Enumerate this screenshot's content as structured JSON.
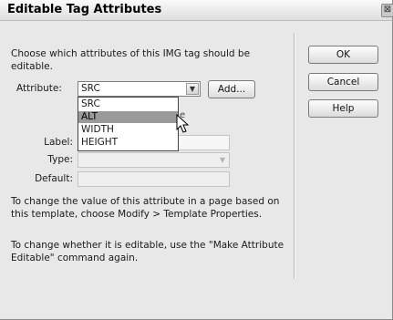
{
  "dialog": {
    "title": "Editable Tag Attributes",
    "close_glyph": "⊠",
    "description": "Choose which attributes of this IMG tag should be editable."
  },
  "attribute": {
    "label": "Attribute:",
    "selected_value": "SRC",
    "options": [
      "SRC",
      "ALT",
      "WIDTH",
      "HEIGHT"
    ],
    "highlighted_index": 1,
    "add_button": "Add..."
  },
  "fields": {
    "label_label": "Label:",
    "type_label": "Type:",
    "default_label": "Default:"
  },
  "hints": {
    "template_hint": "To change the value of this attribute in a page based on this template, choose Modify > Template Properties.",
    "editable_hint": "To change whether it is editable, use the \"Make Attribute Editable\" command again."
  },
  "buttons": {
    "ok": "OK",
    "cancel": "Cancel",
    "help": "Help"
  },
  "icons": {
    "close": "close-icon",
    "dropdown_arrow": "chevron-down-icon",
    "cursor": "mouse-pointer-icon"
  }
}
